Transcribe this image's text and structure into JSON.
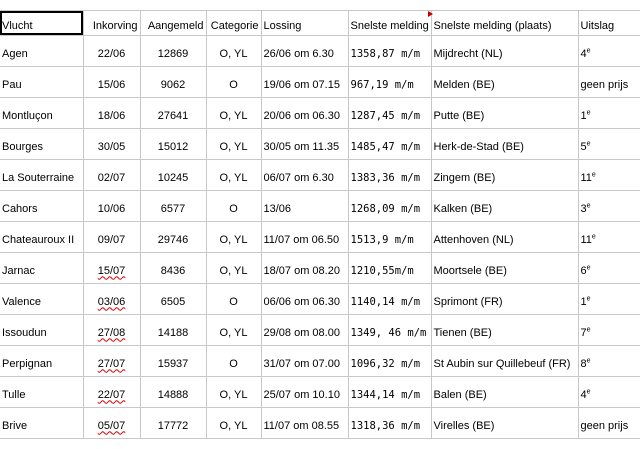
{
  "sheet": {
    "columns": [
      "Vlucht",
      "Inkorving",
      "Aangemeld",
      "Categorie",
      "Lossing",
      "Snelste melding",
      "Snelste melding (plaats)",
      "Uitslag"
    ],
    "rows": [
      {
        "vlucht": "Agen",
        "inkorving": "22/06",
        "aangemeld": "12869",
        "categorie": "O, YL",
        "lossing": "26/06 om 6.30",
        "snelste": "1358,87 m/m",
        "plaats": "Mijdrecht (NL)",
        "uitslag": "4",
        "uitslag_sup": "e",
        "inkorving_flag": false
      },
      {
        "vlucht": "Pau",
        "inkorving": "15/06",
        "aangemeld": "9062",
        "categorie": "O",
        "lossing": "19/06 om 07.15",
        "snelste": "967,19 m/m",
        "plaats": "Melden (BE)",
        "uitslag": "geen prijs",
        "uitslag_sup": "",
        "inkorving_flag": false
      },
      {
        "vlucht": "Montluçon",
        "inkorving": "18/06",
        "aangemeld": "27641",
        "categorie": "O, YL",
        "lossing": "20/06 om 06.30",
        "snelste": "1287,45 m/m",
        "plaats": "Putte (BE)",
        "uitslag": "1",
        "uitslag_sup": "e",
        "inkorving_flag": false
      },
      {
        "vlucht": "Bourges",
        "inkorving": "30/05",
        "aangemeld": "15012",
        "categorie": "O, YL",
        "lossing": "30/05 om 11.35",
        "snelste": "1485,47 m/m",
        "plaats": "Herk-de-Stad (BE)",
        "uitslag": "5",
        "uitslag_sup": "e",
        "inkorving_flag": false
      },
      {
        "vlucht": "La Souterraine",
        "inkorving": "02/07",
        "aangemeld": "10245",
        "categorie": "O, YL",
        "lossing": "06/07 om 6.30",
        "snelste": "1383,36 m/m",
        "plaats": "Zingem (BE)",
        "uitslag": "11",
        "uitslag_sup": "e",
        "inkorving_flag": false
      },
      {
        "vlucht": "Cahors",
        "inkorving": "10/06",
        "aangemeld": "6577",
        "categorie": "O",
        "lossing": "13/06",
        "snelste": "1268,09 m/m",
        "plaats": "Kalken (BE)",
        "uitslag": "3",
        "uitslag_sup": "e",
        "inkorving_flag": false
      },
      {
        "vlucht": "Chateauroux II",
        "inkorving": "09/07",
        "aangemeld": "29746",
        "categorie": "O, YL",
        "lossing": "11/07 om 06.50",
        "snelste": "1513,9 m/m",
        "plaats": "Attenhoven (NL)",
        "uitslag": "11",
        "uitslag_sup": "e",
        "inkorving_flag": false
      },
      {
        "vlucht": "Jarnac",
        "inkorving": "15/07",
        "aangemeld": "8436",
        "categorie": "O, YL",
        "lossing": "18/07 om 08.20",
        "snelste": "1210,55m/m",
        "plaats": "Moortsele (BE)",
        "uitslag": "6",
        "uitslag_sup": "e",
        "inkorving_flag": true
      },
      {
        "vlucht": "Valence",
        "inkorving": "03/06",
        "aangemeld": "6505",
        "categorie": "O",
        "lossing": "06/06 om 06.30",
        "snelste": "1140,14 m/m",
        "plaats": "Sprimont (FR)",
        "uitslag": "1",
        "uitslag_sup": "e",
        "inkorving_flag": true
      },
      {
        "vlucht": "Issoudun",
        "inkorving": "27/08",
        "aangemeld": "14188",
        "categorie": "O, YL",
        "lossing": "29/08 om 08.00",
        "snelste": "1349, 46 m/m",
        "plaats": "Tienen (BE)",
        "uitslag": "7",
        "uitslag_sup": "e",
        "inkorving_flag": true
      },
      {
        "vlucht": "Perpignan",
        "inkorving": "27/07",
        "aangemeld": "15937",
        "categorie": "O",
        "lossing": "31/07 om 07.00",
        "snelste": "1096,32 m/m",
        "plaats": "St Aubin sur Quillebeuf (FR)",
        "uitslag": "8",
        "uitslag_sup": "e",
        "inkorving_flag": true
      },
      {
        "vlucht": "Tulle",
        "inkorving": "22/07",
        "aangemeld": "14888",
        "categorie": "O, YL",
        "lossing": "25/07 om 10.10",
        "snelste": "1344,14 m/m",
        "plaats": "Balen (BE)",
        "uitslag": "4",
        "uitslag_sup": "e",
        "inkorving_flag": true
      },
      {
        "vlucht": "Brive",
        "inkorving": "05/07",
        "aangemeld": "17772",
        "categorie": "O, YL",
        "lossing": "11/07 om 08.55",
        "snelste": "1318,36 m/m",
        "plaats": "Virelles (BE)",
        "uitslag": "geen prijs",
        "uitslag_sup": "",
        "inkorving_flag": true
      }
    ]
  },
  "colors": {
    "grid": "#c8c8c8",
    "selection": "#000000",
    "spellcheck": "#d40000",
    "comment_marker": "#c00000"
  }
}
